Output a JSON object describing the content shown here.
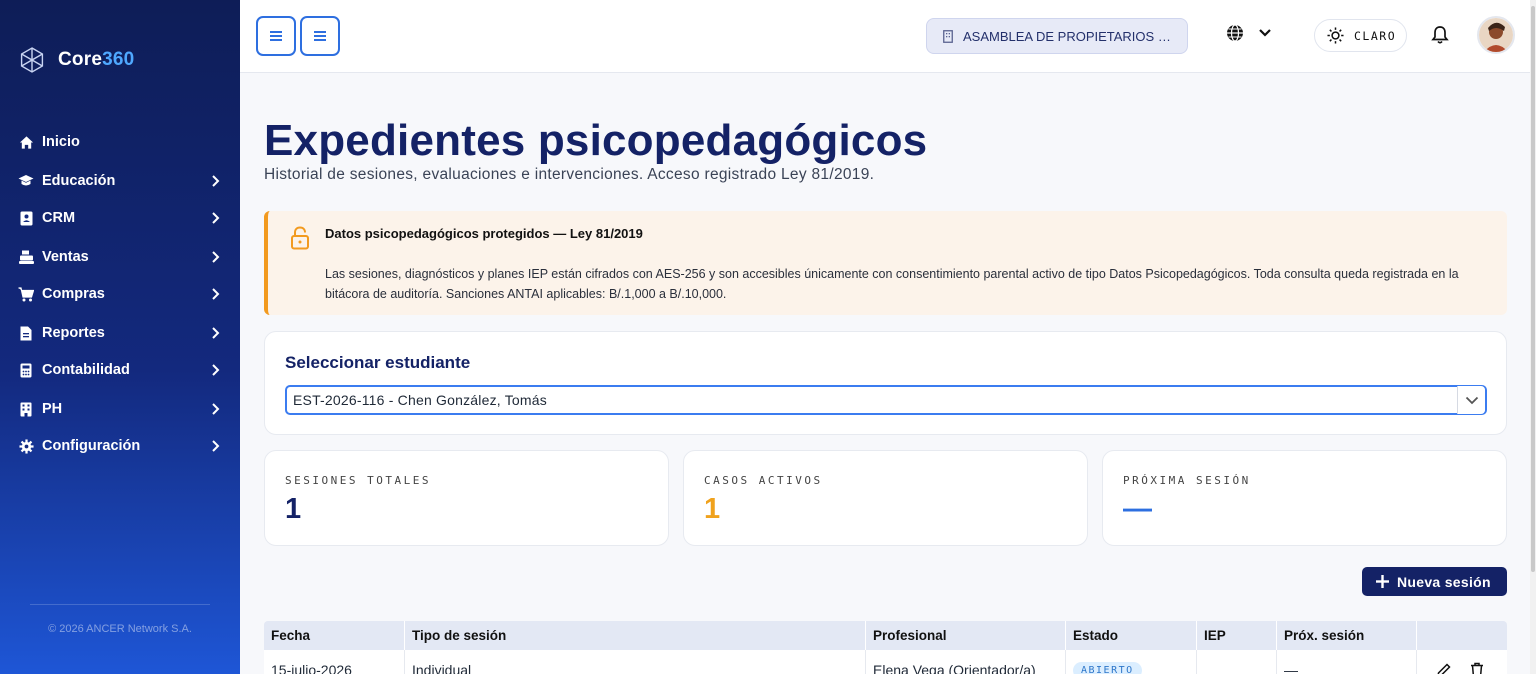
{
  "brand": {
    "name_a": "Core",
    "name_b": "360",
    "accent": "#4fa8ff"
  },
  "sidebar": {
    "items": [
      {
        "label": "Inicio",
        "icon": "home-icon",
        "has_children": false
      },
      {
        "label": "Educación",
        "icon": "graduation-cap-icon",
        "has_children": true
      },
      {
        "label": "CRM",
        "icon": "address-book-icon",
        "has_children": true
      },
      {
        "label": "Ventas",
        "icon": "cash-register-icon",
        "has_children": true
      },
      {
        "label": "Compras",
        "icon": "shopping-cart-icon",
        "has_children": true
      },
      {
        "label": "Reportes",
        "icon": "file-report-icon",
        "has_children": true
      },
      {
        "label": "Contabilidad",
        "icon": "calculator-icon",
        "has_children": true
      },
      {
        "label": "PH",
        "icon": "building-icon",
        "has_children": true
      },
      {
        "label": "Configuración",
        "icon": "gear-icon",
        "has_children": true
      }
    ],
    "copyright": "© 2026 ANCER Network S.A."
  },
  "topbar": {
    "organization": "ASAMBLEA DE PROPIETARIOS DE ...",
    "theme_label": "CLARO"
  },
  "page": {
    "title": "Expedientes psicopedagógicos",
    "subtitle": "Historial de sesiones, evaluaciones e intervenciones. Acceso registrado Ley 81/2019."
  },
  "alert": {
    "title": "Datos psicopedagógicos protegidos — Ley 81/2019",
    "body": "Las sesiones, diagnósticos y planes IEP están cifrados con AES-256 y son accesibles únicamente con consentimiento parental activo de tipo Datos Psicopedagógicos. Toda consulta queda registrada en la bitácora de auditoría. Sanciones ANTAI aplicables: B/.1,000 a B/.10,000.",
    "accent_color": "#f29a1f"
  },
  "student_selector": {
    "title": "Seleccionar estudiante",
    "selected": "EST-2026-116 - Chen González, Tomás"
  },
  "stats": [
    {
      "label": "SESIONES TOTALES",
      "value": "1",
      "color": "#142266"
    },
    {
      "label": "CASOS ACTIVOS",
      "value": "1",
      "color": "#f0a21d"
    },
    {
      "label": "PRÓXIMA SESIÓN",
      "value": "—",
      "color": "#2d6fe0"
    }
  ],
  "new_session_button": "Nueva sesión",
  "table": {
    "columns": [
      "Fecha",
      "Tipo de sesión",
      "Profesional",
      "Estado",
      "IEP",
      "Próx. sesión",
      ""
    ],
    "rows": [
      {
        "fecha": "15-julio-2026",
        "tipo": "Individual",
        "profesional": "Elena Vega (Orientador/a)",
        "estado": "ABIERTO",
        "iep": "",
        "prox": "—"
      }
    ]
  }
}
